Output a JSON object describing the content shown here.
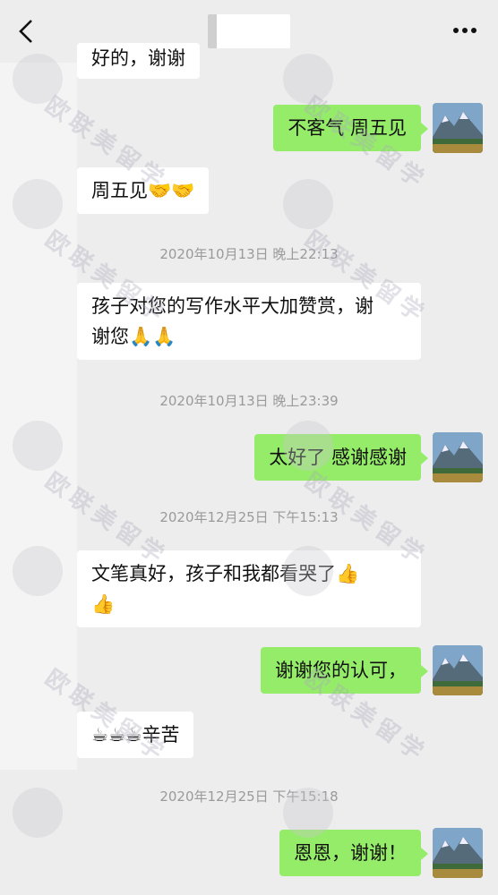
{
  "header": {
    "back_icon": "chevron-left-icon",
    "more_icon": "more-dots-icon"
  },
  "messages": [
    {
      "id": "m0",
      "side": "in",
      "text": "好的，谢谢"
    },
    {
      "id": "m1",
      "side": "out",
      "text": "不客气 周五见"
    },
    {
      "id": "m2",
      "side": "in",
      "text": "周五见🤝🤝"
    },
    {
      "id": "t1",
      "type": "time",
      "text": "2020年10月13日 晚上22:13"
    },
    {
      "id": "m3",
      "side": "in",
      "text": "孩子对您的写作水平大加赞赏，谢\n谢您🙏🙏"
    },
    {
      "id": "t2",
      "type": "time",
      "text": "2020年10月13日 晚上23:39"
    },
    {
      "id": "m4",
      "side": "out",
      "text": "太好了 感谢感谢"
    },
    {
      "id": "t3",
      "type": "time",
      "text": "2020年12月25日 下午15:13"
    },
    {
      "id": "m5",
      "side": "in",
      "text": "文笔真好，孩子和我都看哭了👍\n👍"
    },
    {
      "id": "m6",
      "side": "out",
      "text": "谢谢您的认可，"
    },
    {
      "id": "m7",
      "side": "in",
      "text": "☕☕☕辛苦"
    },
    {
      "id": "t4",
      "type": "time",
      "text": "2020年12月25日 下午15:18"
    },
    {
      "id": "m8",
      "side": "out",
      "text": "恩恩，谢谢！"
    }
  ],
  "watermark": {
    "text": "欧联美留学"
  },
  "colors": {
    "outgoing_bubble": "#95ec69",
    "incoming_bubble": "#ffffff",
    "background": "#ededed"
  }
}
